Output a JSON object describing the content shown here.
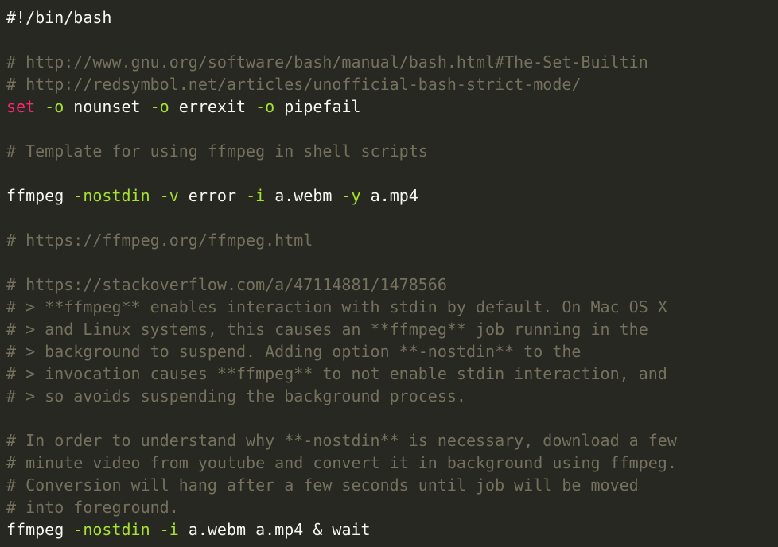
{
  "editor": {
    "theme": {
      "background": "#272822",
      "foreground": "#f8f8f2",
      "comment": "#75715e",
      "keyword": "#f92672",
      "flag": "#a6e22e"
    },
    "lines": [
      [
        {
          "t": "plain",
          "v": "#!/bin/bash"
        }
      ],
      [],
      [
        {
          "t": "comment",
          "v": "# http://www.gnu.org/software/bash/manual/bash.html#The-Set-Builtin"
        }
      ],
      [
        {
          "t": "comment",
          "v": "# http://redsymbol.net/articles/unofficial-bash-strict-mode/"
        }
      ],
      [
        {
          "t": "keyword",
          "v": "set"
        },
        {
          "t": "plain",
          "v": " "
        },
        {
          "t": "flag",
          "v": "-o"
        },
        {
          "t": "plain",
          "v": " nounset "
        },
        {
          "t": "flag",
          "v": "-o"
        },
        {
          "t": "plain",
          "v": " errexit "
        },
        {
          "t": "flag",
          "v": "-o"
        },
        {
          "t": "plain",
          "v": " pipefail"
        }
      ],
      [],
      [
        {
          "t": "comment",
          "v": "# Template for using ffmpeg in shell scripts"
        }
      ],
      [],
      [
        {
          "t": "plain",
          "v": "ffmpeg "
        },
        {
          "t": "flag",
          "v": "-nostdin"
        },
        {
          "t": "plain",
          "v": " "
        },
        {
          "t": "flag",
          "v": "-v"
        },
        {
          "t": "plain",
          "v": " error "
        },
        {
          "t": "flag",
          "v": "-i"
        },
        {
          "t": "plain",
          "v": " a.webm "
        },
        {
          "t": "flag",
          "v": "-y"
        },
        {
          "t": "plain",
          "v": " a.mp4"
        }
      ],
      [],
      [
        {
          "t": "comment",
          "v": "# https://ffmpeg.org/ffmpeg.html"
        }
      ],
      [],
      [
        {
          "t": "comment",
          "v": "# https://stackoverflow.com/a/47114881/1478566"
        }
      ],
      [
        {
          "t": "comment",
          "v": "# > **ffmpeg** enables interaction with stdin by default. On Mac OS X"
        }
      ],
      [
        {
          "t": "comment",
          "v": "# > and Linux systems, this causes an **ffmpeg** job running in the"
        }
      ],
      [
        {
          "t": "comment",
          "v": "# > background to suspend. Adding option **-nostdin** to the"
        }
      ],
      [
        {
          "t": "comment",
          "v": "# > invocation causes **ffmpeg** to not enable stdin interaction, and"
        }
      ],
      [
        {
          "t": "comment",
          "v": "# > so avoids suspending the background process."
        }
      ],
      [],
      [
        {
          "t": "comment",
          "v": "# In order to understand why **-nostdin** is necessary, download a few"
        }
      ],
      [
        {
          "t": "comment",
          "v": "# minute video from youtube and convert it in background using ffmpeg."
        }
      ],
      [
        {
          "t": "comment",
          "v": "# Conversion will hang after a few seconds until job will be moved"
        }
      ],
      [
        {
          "t": "comment",
          "v": "# into foreground."
        }
      ],
      [
        {
          "t": "plain",
          "v": "ffmpeg "
        },
        {
          "t": "flag",
          "v": "-nostdin"
        },
        {
          "t": "plain",
          "v": " "
        },
        {
          "t": "flag",
          "v": "-i"
        },
        {
          "t": "plain",
          "v": " a.webm a.mp4 & wait"
        }
      ]
    ]
  }
}
